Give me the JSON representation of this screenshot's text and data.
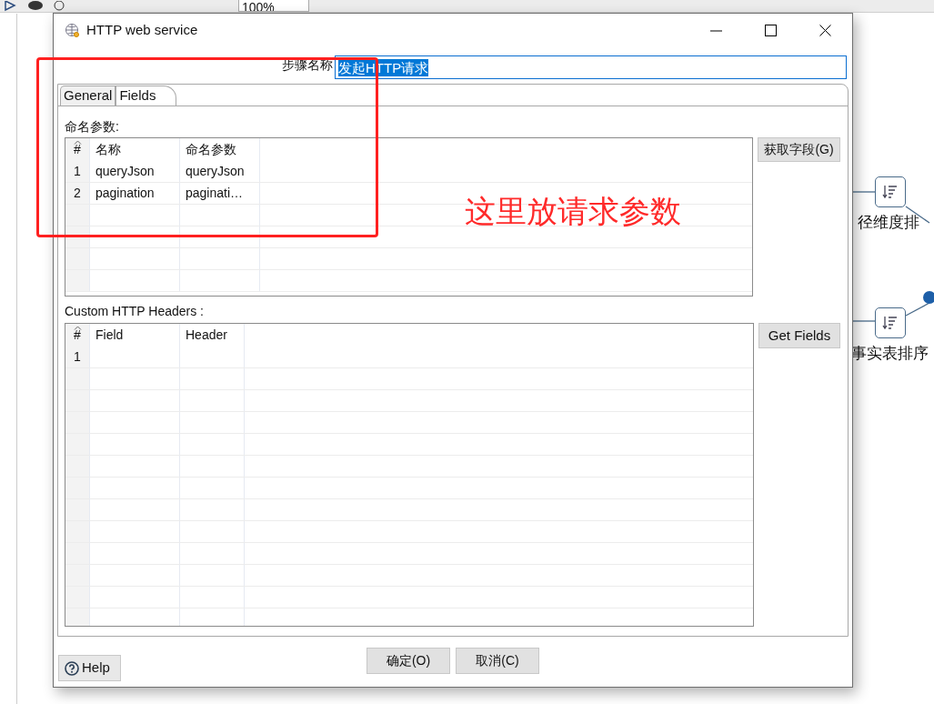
{
  "background": {
    "zoom": "100%",
    "nodes": [
      {
        "label": "径维度排"
      },
      {
        "label": "事实表排序"
      }
    ]
  },
  "dialog": {
    "title": "HTTP web service",
    "step_name": {
      "label": "步骤名称",
      "value": "发起HTTP请求",
      "highlighted": true
    },
    "tabs": [
      {
        "label": "General",
        "selected": false
      },
      {
        "label": "Fields",
        "selected": true
      }
    ],
    "parameters": {
      "label": "命名参数:",
      "columns": [
        "#",
        "名称",
        "命名参数"
      ],
      "rows": [
        {
          "number": "1",
          "name": "queryJson",
          "parameter": "queryJson"
        },
        {
          "number": "2",
          "name": "pagination",
          "parameter": "paginati…"
        }
      ],
      "button": "获取字段(G)"
    },
    "headers": {
      "label": "Custom HTTP Headers :",
      "columns": [
        "#",
        "Field",
        "Header"
      ],
      "rows": [
        {
          "number": "1"
        }
      ],
      "button": "Get Fields"
    },
    "help": "Help",
    "ok": "确定(O)",
    "cancel": "取消(C)"
  },
  "annotation": {
    "text": "这里放请求参数"
  }
}
